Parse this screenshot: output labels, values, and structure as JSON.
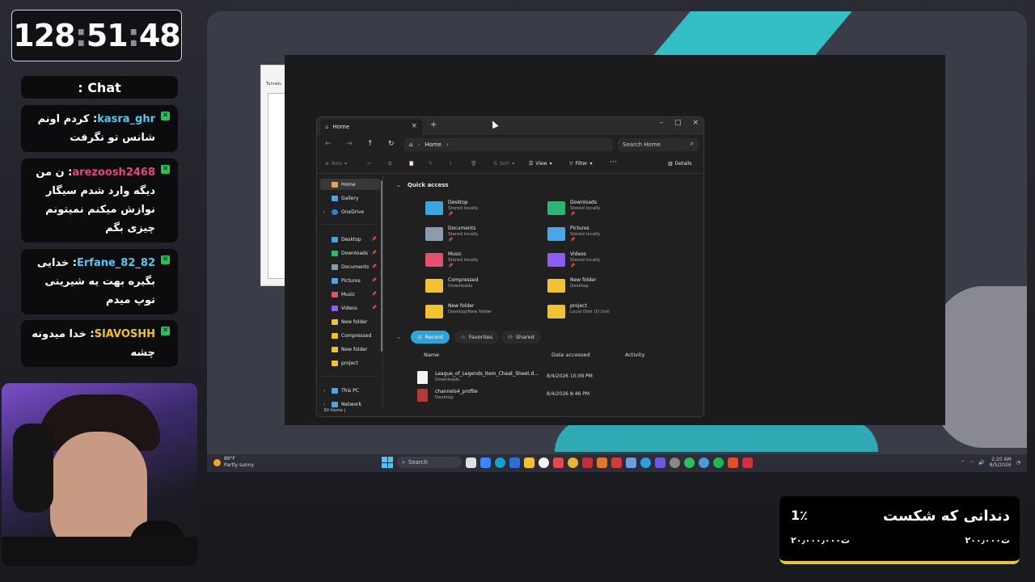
{
  "timer": {
    "hours": "128",
    "minutes": "51",
    "seconds": "48"
  },
  "chat": {
    "title": ": Chat",
    "messages": [
      {
        "user": "kasra_ghr",
        "user_color": "#52c8f0",
        "text": "کردم اونم شانس تو نگرفت"
      },
      {
        "user": "arezoosh2468",
        "user_color": "#e04a78",
        "text": "ن من دیگه وارد شدم سیگار نوازش میکنم نمیتونم چیزی بگم"
      },
      {
        "user": "Erfane_82_82",
        "user_color": "#52c8f0",
        "text": "خدایی بگیره بهت یه شیرینی توپ میدم"
      },
      {
        "user": "SIAVOSHH",
        "user_color": "#f0c419",
        "text": "خدا میدونه چشه"
      }
    ]
  },
  "goal": {
    "title": "دندانی که شکست",
    "percent": "1٪",
    "current": "۲۰٫۰۰۰٫۰۰۰ت",
    "target": "۲۰۰٫۰۰۰ت"
  },
  "bg_app": {
    "label": "Tunnels"
  },
  "explorer": {
    "tab_label": "Home",
    "breadcrumb": "Home",
    "search_placeholder": "Search Home",
    "commands": {
      "new": "New",
      "sort": "Sort",
      "view": "View",
      "filter": "Filter",
      "more": "···",
      "details": "Details"
    },
    "nav": [
      {
        "label": "Home",
        "icon": "home-icon"
      },
      {
        "label": "Gallery",
        "icon": "gallery-icon"
      },
      {
        "label": "OneDrive",
        "icon": "cloud-icon"
      },
      {
        "label": "Desktop",
        "icon": "desktop-icon"
      },
      {
        "label": "Downloads",
        "icon": "download-icon"
      },
      {
        "label": "Documents",
        "icon": "document-icon"
      },
      {
        "label": "Pictures",
        "icon": "pictures-icon"
      },
      {
        "label": "Music",
        "icon": "music-icon"
      },
      {
        "label": "Videos",
        "icon": "video-icon"
      },
      {
        "label": "New folder",
        "icon": "folder-icon"
      },
      {
        "label": "Compressed",
        "icon": "folder-icon"
      },
      {
        "label": "New folder",
        "icon": "folder-icon"
      },
      {
        "label": "project",
        "icon": "folder-icon"
      },
      {
        "label": "This PC",
        "icon": "computer-icon"
      },
      {
        "label": "Network",
        "icon": "network-icon"
      }
    ],
    "quick_access_title": "Quick access",
    "quick_access": [
      {
        "name": "Desktop",
        "sub": "Stored locally",
        "pin": "📌",
        "color": "#3aa8e0"
      },
      {
        "name": "Downloads",
        "sub": "Stored locally",
        "pin": "📌",
        "color": "#2bb673"
      },
      {
        "name": "Documents",
        "sub": "Stored locally",
        "pin": "📌",
        "color": "#8c9bb0"
      },
      {
        "name": "Pictures",
        "sub": "Stored locally",
        "pin": "📌",
        "color": "#4aa6e8"
      },
      {
        "name": "Music",
        "sub": "Stored locally",
        "pin": "📌",
        "color": "#e8506a"
      },
      {
        "name": "Videos",
        "sub": "Stored locally",
        "pin": "📌",
        "color": "#8b5cf6"
      },
      {
        "name": "Compressed",
        "sub": "Downloads",
        "pin": "",
        "color": "#f2c230"
      },
      {
        "name": "New folder",
        "sub": "Desktop",
        "pin": "",
        "color": "#f2c230"
      },
      {
        "name": "New folder",
        "sub": "Desktop\\New folder",
        "pin": "",
        "color": "#f2c230"
      },
      {
        "name": "project",
        "sub": "Local Disk (D:)\\sit",
        "pin": "",
        "color": "#f2c230"
      }
    ],
    "chips": {
      "recent": "Recent",
      "favorites": "Favorites",
      "shared": "Shared"
    },
    "columns": {
      "name": "Name",
      "date": "Date accessed",
      "activity": "Activity"
    },
    "files": [
      {
        "name": "League_of_Legends_Item_Cheat_Sheet.d...",
        "loc": "Downloads",
        "date": "8/4/2026 10:09 PM"
      },
      {
        "name": "channels4_profile",
        "loc": "Desktop",
        "date": "8/4/2026 8:46 PM"
      }
    ],
    "status": "30 items  |"
  },
  "taskbar": {
    "weather_temp": "89°F",
    "weather_text": "Partly sunny",
    "search_label": "Search",
    "time": "2:20 AM",
    "date": "8/5/2026"
  }
}
